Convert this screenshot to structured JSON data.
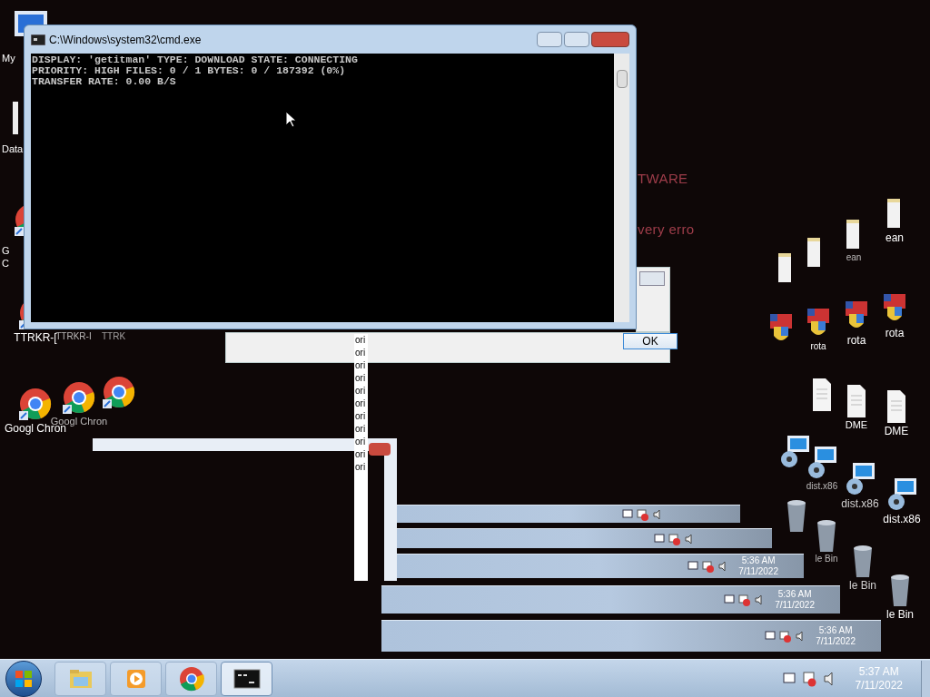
{
  "desktop_icons": [
    {
      "kind": "computer",
      "label": "My"
    },
    {
      "kind": "document",
      "label": "Data"
    },
    {
      "kind": "chrome",
      "label": "G C"
    },
    {
      "kind": "chrome",
      "label": "TTRKR-["
    },
    {
      "kind": "blank",
      "label": "TTRKR-I"
    },
    {
      "kind": "blank",
      "label": "TTRK"
    },
    {
      "kind": "chrome",
      "label": "Googl Chron"
    },
    {
      "kind": "chrome",
      "label": "Googl Chron"
    },
    {
      "kind": "chrome"
    },
    {
      "kind": "folder",
      "label": "ean"
    },
    {
      "kind": "folder",
      "label": "ean"
    },
    {
      "kind": "folder"
    },
    {
      "kind": "folder"
    },
    {
      "kind": "installer",
      "label": "rota"
    },
    {
      "kind": "installer",
      "label": "rota"
    },
    {
      "kind": "installer",
      "label": "rota"
    },
    {
      "kind": "installer"
    },
    {
      "kind": "file",
      "label": "DME"
    },
    {
      "kind": "file",
      "label": "DME"
    },
    {
      "kind": "file"
    },
    {
      "kind": "setup",
      "label": "dist.x86"
    },
    {
      "kind": "setup",
      "label": "dist.x86"
    },
    {
      "kind": "setup",
      "label": "dist.x86"
    },
    {
      "kind": "setup"
    },
    {
      "kind": "bin",
      "label": "le Bin"
    },
    {
      "kind": "bin",
      "label": "le Bin"
    },
    {
      "kind": "bin",
      "label": "le Bin"
    },
    {
      "kind": "bin"
    }
  ],
  "ghost_texts": [
    "TWARE",
    "very erro"
  ],
  "cmd_window": {
    "title": "C:\\Windows\\system32\\cmd.exe",
    "lines": [
      "DISPLAY: 'getitman' TYPE: DOWNLOAD STATE: CONNECTING",
      "PRIORITY: HIGH FILES: 0 / 1 BYTES: 0 / 187392 (0%)",
      "TRANSFER RATE: 0.00 B/S"
    ]
  },
  "dialog": {
    "ok_button": "OK",
    "clipped_lines": [
      "ori",
      "ori",
      "ori",
      "ori",
      "ori",
      "ori",
      "ori",
      "ori",
      "ori",
      "ori",
      "ori"
    ]
  },
  "ghost_taskbars": [
    {
      "kind": "blank"
    },
    {
      "kind": "blank"
    },
    {
      "kind": "clock",
      "time": "5:36 AM",
      "date": "7/11/2022"
    },
    {
      "kind": "clock",
      "time": "5:36 AM",
      "date": "7/11/2022"
    },
    {
      "kind": "clock",
      "time": "5:36 AM",
      "date": "7/11/2022"
    }
  ],
  "taskbar": {
    "apps": [
      {
        "kind": "explorer",
        "selected": false
      },
      {
        "kind": "media",
        "selected": false
      },
      {
        "kind": "chrome",
        "selected": false
      },
      {
        "kind": "console",
        "selected": true
      }
    ],
    "clock": {
      "time": "5:37 AM",
      "date": "7/11/2022"
    }
  }
}
